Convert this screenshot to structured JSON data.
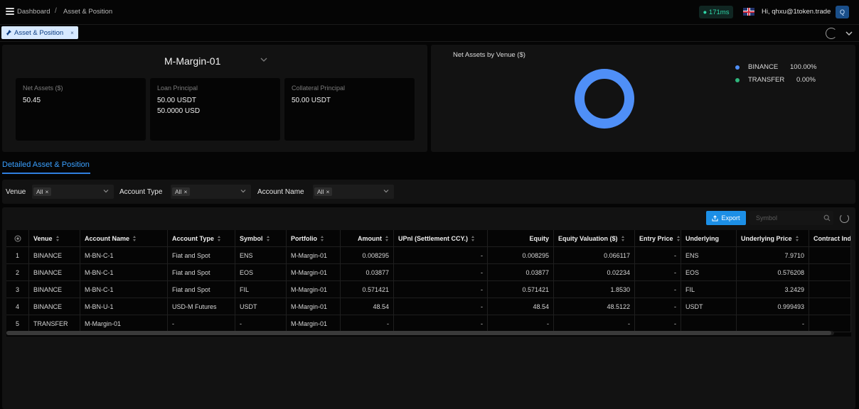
{
  "breadcrumb": {
    "home": "Dashboard",
    "separator": "/",
    "current": "Asset & Position"
  },
  "header": {
    "latency": "● 171ms",
    "user_greeting": "Hi, qhxu@1token.trade",
    "avatar_letter": "Q",
    "flag_icon": "uk-flag-icon"
  },
  "tabs": [
    {
      "label": "Asset & Position",
      "close": "×"
    }
  ],
  "summary": {
    "portfolio_name": "M-Margin-01",
    "cards": [
      {
        "label": "Net Assets ($)",
        "values": [
          "50.45"
        ]
      },
      {
        "label": "Loan Principal",
        "values": [
          "50.00 USDT",
          "50.0000 USD"
        ]
      },
      {
        "label": "Collateral Principal",
        "values": [
          "50.00 USDT"
        ]
      }
    ]
  },
  "venue_chart": {
    "title": "Net Assets by Venue ($)",
    "legend": [
      {
        "name": "BINANCE",
        "value": "100.00%",
        "color": "#4f8ff7"
      },
      {
        "name": "TRANSFER",
        "value": "0.00%",
        "color": "#2fb57c"
      }
    ]
  },
  "chart_data": {
    "type": "pie",
    "title": "Net Assets by Venue ($)",
    "categories": [
      "BINANCE",
      "TRANSFER"
    ],
    "values": [
      100.0,
      0.0
    ],
    "colors": [
      "#4f8ff7",
      "#2fb57c"
    ],
    "donut": true,
    "legend_position": "right"
  },
  "section": {
    "title": "Detailed Asset & Position"
  },
  "filters": [
    {
      "label": "Venue",
      "chip": "All"
    },
    {
      "label": "Account Type",
      "chip": "All"
    },
    {
      "label": "Account Name",
      "chip": "All"
    }
  ],
  "toolbar": {
    "export_label": "Export",
    "symbol_placeholder": "Symbol"
  },
  "table": {
    "columns": [
      "Venue",
      "Account Name",
      "Account Type",
      "Symbol",
      "Portfolio",
      "Amount",
      "UPnl (Settlement CCY.)",
      "Equity",
      "Equity Valuation ($)",
      "Entry Price",
      "Underlying",
      "Underlying Price",
      "Contract Ind"
    ],
    "rows": [
      [
        "1",
        "BINANCE",
        "M-BN-C-1",
        "Fiat and Spot",
        "ENS",
        "M-Margin-01",
        "0.008295",
        "-",
        "0.008295",
        "0.066117",
        "-",
        "ENS",
        "7.9710",
        ""
      ],
      [
        "2",
        "BINANCE",
        "M-BN-C-1",
        "Fiat and Spot",
        "EOS",
        "M-Margin-01",
        "0.03877",
        "-",
        "0.03877",
        "0.02234",
        "-",
        "EOS",
        "0.576208",
        ""
      ],
      [
        "3",
        "BINANCE",
        "M-BN-C-1",
        "Fiat and Spot",
        "FIL",
        "M-Margin-01",
        "0.571421",
        "-",
        "0.571421",
        "1.8530",
        "-",
        "FIL",
        "3.2429",
        ""
      ],
      [
        "4",
        "BINANCE",
        "M-BN-U-1",
        "USD-M Futures",
        "USDT",
        "M-Margin-01",
        "48.54",
        "-",
        "48.54",
        "48.5122",
        "-",
        "USDT",
        "0.999493",
        ""
      ],
      [
        "5",
        "TRANSFER",
        "M-Margin-01",
        "-",
        "-",
        "M-Margin-01",
        "-",
        "-",
        "-",
        "-",
        "-",
        "",
        "-",
        ""
      ]
    ]
  }
}
